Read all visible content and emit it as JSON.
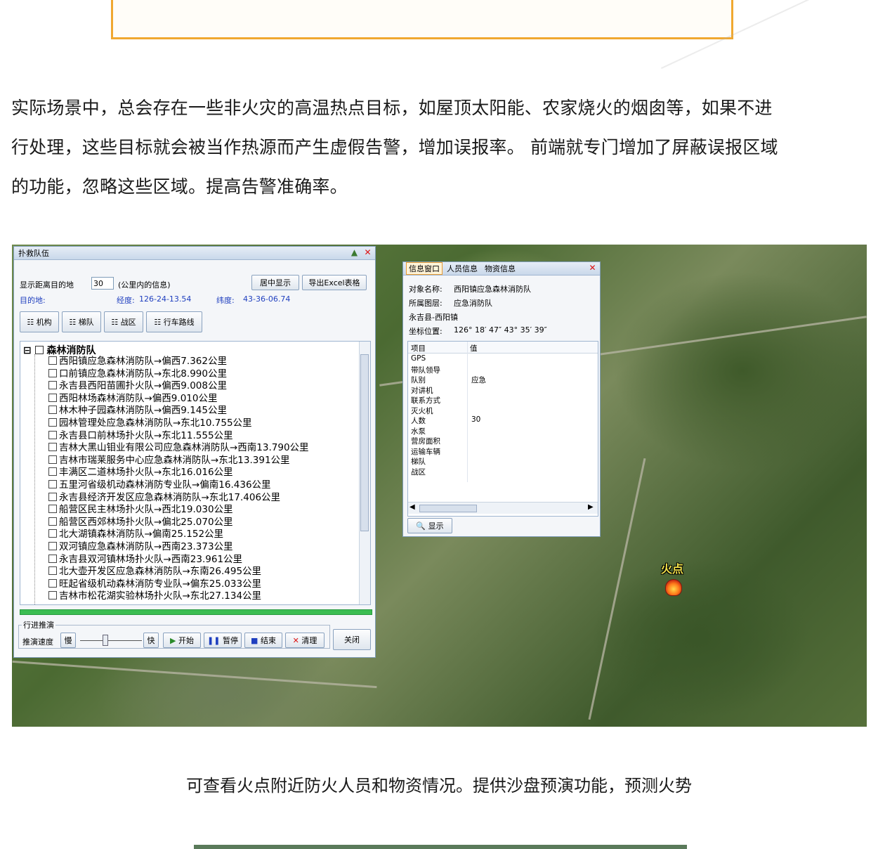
{
  "paragraph": {
    "lines": [
      "实际场景中，总会存在一些非火灾的高温热点目标，如屋顶太阳能、农家烧火的烟囱等，如果不进",
      "行处理，这些目标就会被当作热源而产生虚假告警，增加误报率。 前端就专门增加了屏蔽误报区域",
      "的功能，忽略这些区域。提高告警准确率。"
    ]
  },
  "rescue_window": {
    "title": "扑救队伍",
    "distance_label": "显示距离目的地",
    "distance_value": "30",
    "distance_unit": "(公里内的信息)",
    "center_button": "居中显示",
    "export_button": "导出Excel表格",
    "destination_label": "目的地:",
    "longitude_label": "经度:",
    "longitude_value": "126-24-13.54",
    "latitude_label": "纬度:",
    "latitude_value": "43-36-06.74",
    "tabs": [
      "机构",
      "梯队",
      "战区",
      "行车路线"
    ],
    "tree_root": "森林消防队",
    "tree_items": [
      "西阳镇应急森林消防队→偏西7.362公里",
      "口前镇应急森林消防队→东北8.990公里",
      "永吉县西阳苗圃扑火队→偏西9.008公里",
      "西阳林场森林消防队→偏西9.010公里",
      "林木种子园森林消防队→偏西9.145公里",
      "园林管理处应急森林消防队→东北10.755公里",
      "永吉县口前林场扑火队→东北11.555公里",
      "吉林大黑山钼业有限公司应急森林消防队→西南13.790公里",
      "吉林市瑞莱服务中心应急森林消防队→东北13.391公里",
      "丰满区二道林场扑火队→东北16.016公里",
      "五里河省级机动森林消防专业队→偏南16.436公里",
      "永吉县经济开发区应急森林消防队→东北17.406公里",
      "船营区民主林场扑火队→西北19.030公里",
      "船营区西郊林场扑火队→偏北25.070公里",
      "北大湖镇森林消防队→偏南25.152公里",
      "双河镇应急森林消防队→西南23.373公里",
      "永吉县双河镇林场扑火队→西南23.961公里",
      "北大壶开发区应急森林消防队→东南26.495公里",
      "旺起省级机动森林消防专业队→偏东25.033公里",
      "吉林市松花湖实验林场扑火队→东北27.134公里"
    ],
    "playback_group": "行进推演",
    "speed_label": "推演速度",
    "slow_label": "慢",
    "fast_label": "快",
    "start_button": "开始",
    "pause_button": "暂停",
    "stop_button": "结束",
    "clear_button": "清理",
    "close_button": "关闭"
  },
  "info_window": {
    "tabs": [
      "信息窗口",
      "人员信息",
      "物资信息"
    ],
    "object_name_label": "对象名称:",
    "object_name_value": "西阳镇应急森林消防队",
    "layer_label": "所属图层:",
    "layer_value": "应急消防队",
    "region": "永吉县-西阳镇",
    "coord_label": "坐标位置:",
    "coord_value": "126° 18′ 47″  43° 35′ 39″",
    "col_item": "项目",
    "col_value": "值",
    "rows": [
      {
        "k": "GPS",
        "v": ""
      },
      {
        "k": "带队领导",
        "v": ""
      },
      {
        "k": "队别",
        "v": "应急"
      },
      {
        "k": "对讲机",
        "v": ""
      },
      {
        "k": "联系方式",
        "v": ""
      },
      {
        "k": "灭火机",
        "v": ""
      },
      {
        "k": "人数",
        "v": "30"
      },
      {
        "k": "水泵",
        "v": ""
      },
      {
        "k": "营房面积",
        "v": ""
      },
      {
        "k": "运输车辆",
        "v": ""
      },
      {
        "k": "梯队",
        "v": ""
      },
      {
        "k": "战区",
        "v": ""
      }
    ],
    "show_button": "显示"
  },
  "map": {
    "fire_label": "火点"
  },
  "caption": "可查看火点附近防火人员和物资情况。提供沙盘预演功能，预测火势"
}
